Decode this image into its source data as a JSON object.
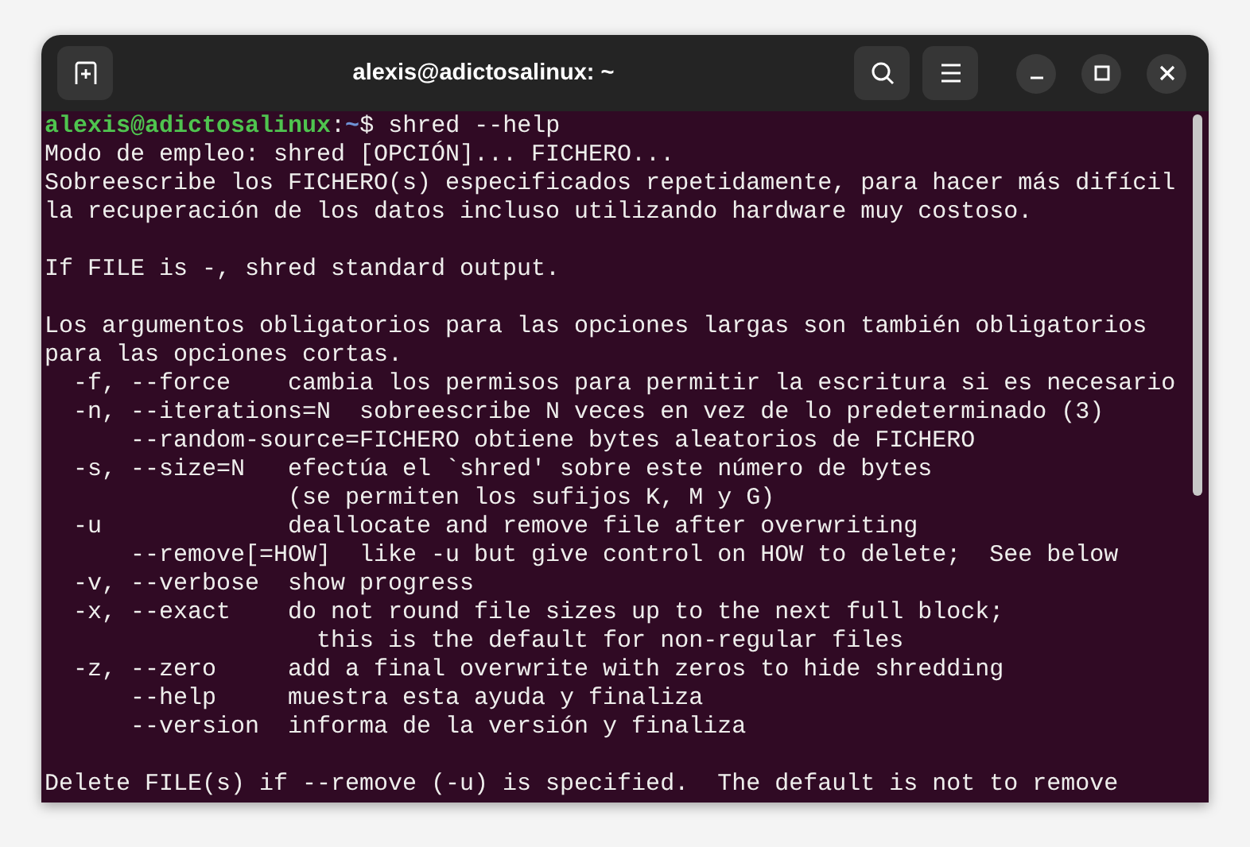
{
  "window": {
    "title": "alexis@adictosalinux: ~"
  },
  "terminal": {
    "prompt": {
      "user_host": "alexis@adictosalinux",
      "separator": ":",
      "path": "~",
      "input": "$ shred --help"
    },
    "paragraphs": [
      [
        "Modo de empleo: shred [OPCIÓN]... FICHERO...",
        "Sobreescribe los FICHERO(s) especificados repetidamente, para hacer más difícil",
        "la recuperación de los datos incluso utilizando hardware muy costoso."
      ],
      [
        "If FILE is -, shred standard output."
      ],
      [
        "Los argumentos obligatorios para las opciones largas son también obligatorios",
        "para las opciones cortas.",
        "  -f, --force    cambia los permisos para permitir la escritura si es necesario",
        "  -n, --iterations=N  sobreescribe N veces en vez de lo predeterminado (3)",
        "      --random-source=FICHERO obtiene bytes aleatorios de FICHERO",
        "  -s, --size=N   efectúa el `shred' sobre este número de bytes",
        "                 (se permiten los sufijos K, M y G)",
        "  -u             deallocate and remove file after overwriting",
        "      --remove[=HOW]  like -u but give control on HOW to delete;  See below",
        "  -v, --verbose  show progress",
        "  -x, --exact    do not round file sizes up to the next full block;",
        "                   this is the default for non-regular files",
        "  -z, --zero     add a final overwrite with zeros to hide shredding",
        "      --help     muestra esta ayuda y finaliza",
        "      --version  informa de la versión y finaliza"
      ],
      [
        "Delete FILE(s) if --remove (-u) is specified.  The default is not to remove"
      ]
    ]
  }
}
